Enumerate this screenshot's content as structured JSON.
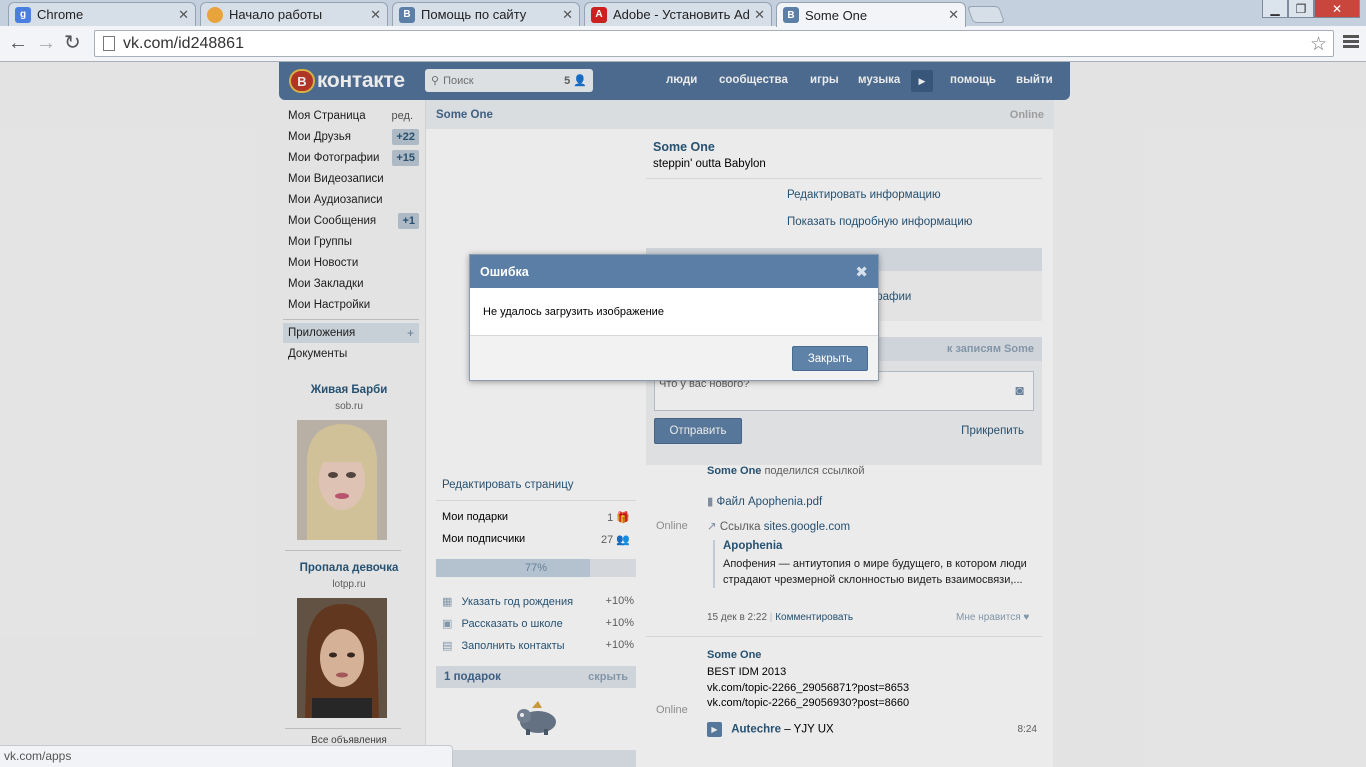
{
  "browser": {
    "tabs": [
      {
        "title": "Chrome",
        "icon": "google-icon",
        "color": "#4a7ee0"
      },
      {
        "title": "Начало работы",
        "icon": "chrome-icon",
        "color": "#e8a33a"
      },
      {
        "title": "Помощь по сайту",
        "icon": "vk-icon",
        "color": "#5b7fa6"
      },
      {
        "title": "Adobe - Установить Adob",
        "icon": "adobe-icon",
        "color": "#cc1f1f"
      },
      {
        "title": "Some One",
        "icon": "vk-icon",
        "color": "#5b7fa6",
        "active": true
      }
    ],
    "url": "vk.com/id248861",
    "status_url": "vk.com/apps"
  },
  "vk": {
    "logo_text": "контакте",
    "logo_badge": "В",
    "search_placeholder": "Поиск",
    "search_count": "5",
    "nav": [
      "люди",
      "сообщества",
      "игры",
      "музыка",
      "помощь",
      "выйти"
    ],
    "left_menu": [
      {
        "label": "Моя Страница",
        "extra": "ред."
      },
      {
        "label": "Мои Друзья",
        "badge": "+22"
      },
      {
        "label": "Мои Фотографии",
        "badge": "+15"
      },
      {
        "label": "Мои Видеозаписи"
      },
      {
        "label": "Мои Аудиозаписи"
      },
      {
        "label": "Мои Сообщения",
        "badge": "+1"
      },
      {
        "label": "Мои Группы"
      },
      {
        "label": "Мои Новости"
      },
      {
        "label": "Мои Закладки"
      },
      {
        "label": "Мои Настройки"
      }
    ],
    "apps_label": "Приложения",
    "apps_plus": "+",
    "docs_label": "Документы",
    "ads": [
      {
        "title": "Живая Барби",
        "site": "sob.ru"
      },
      {
        "title": "Пропала девочка",
        "site": "lotpp.ru"
      }
    ],
    "ads_all": "Все объявления",
    "profile": {
      "name": "Some One",
      "online": "Online",
      "status": "steppin' outta Babylon",
      "edit_info": "Редактировать информацию",
      "show_info": "Показать подробную информацию",
      "photos_fragment": "графии",
      "wall_link": "к записям Some",
      "post_placeholder": "Что у вас нового?",
      "send_btn": "Отправить",
      "attach": "Прикрепить",
      "edit_page": "Редактировать страницу",
      "gifts_label": "Мои подарки",
      "gifts_count": "1",
      "subs_label": "Мои подписчики",
      "subs_count": "27",
      "progress_text": "77%",
      "progress_value": 0.77,
      "tasks": [
        {
          "label": "Указать год рождения",
          "pct": "+10%",
          "icon": "gift-icon"
        },
        {
          "label": "Рассказать о школе",
          "pct": "+10%",
          "icon": "briefcase-icon"
        },
        {
          "label": "Заполнить контакты",
          "pct": "+10%",
          "icon": "phone-icon"
        }
      ],
      "gifts_block": "1 подарок",
      "gifts_hide": "скрыть"
    },
    "posts": [
      {
        "author": "Some One",
        "action": "поделился ссылкой",
        "online": "Online",
        "file": "Файл Apophenia.pdf",
        "link_prefix": "Ссылка",
        "link": "sites.google.com",
        "card_title": "Apophenia",
        "card_text": "Апофения — антиутопия о мире будущего, в котором люди страдают чрезмерной склонностью видеть взаимосвязи,...",
        "date": "15 дек в 2:22",
        "comment": "Комментировать",
        "like": "Мне нравится"
      },
      {
        "author": "Some One",
        "online": "Online",
        "text1": "BEST IDM 2013",
        "text2": "vk.com/topic-2266_29056871?post=8653",
        "text3": "vk.com/topic-2266_29056930?post=8660",
        "audio_artist": "Autechre",
        "audio_title": "YJY UX",
        "audio_sep": "–",
        "audio_time": "8:24"
      }
    ]
  },
  "dialog": {
    "title": "Ошибка",
    "message": "Не удалось загрузить изображение",
    "close_btn": "Закрыть"
  }
}
